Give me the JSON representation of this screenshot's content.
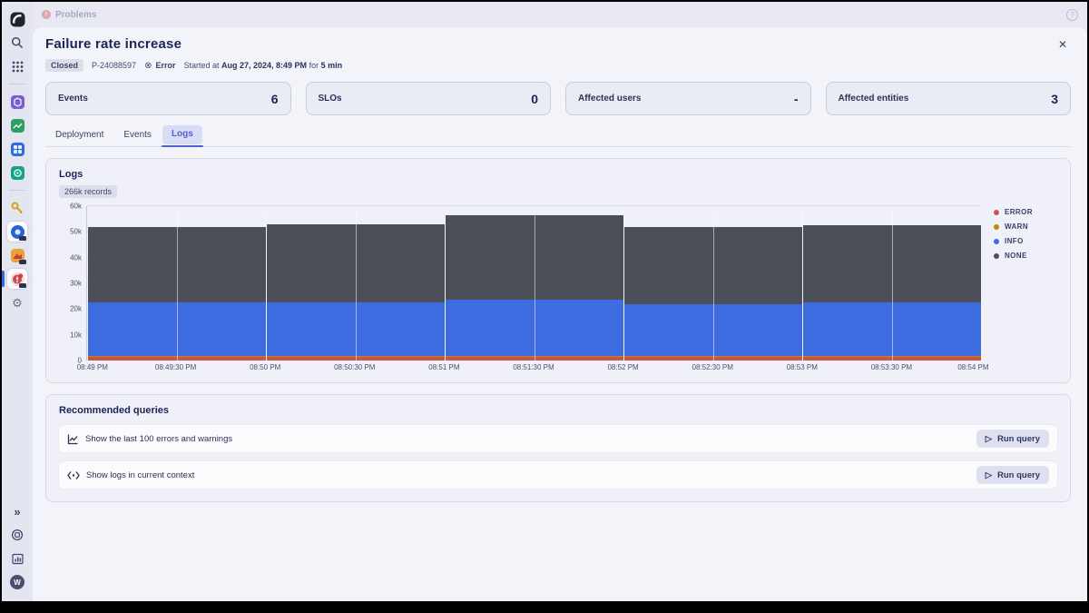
{
  "topbar": {
    "tab_label": "Problems",
    "help_glyph": "?"
  },
  "icons": {
    "close": "✕",
    "error_circle": "⊗",
    "gear": "⚙",
    "expand": "»",
    "play": "▷",
    "problem_bang": "!"
  },
  "sidebar": {
    "user_initial": "W",
    "items": [
      "dynatrace-logo",
      "search",
      "app-grid",
      "kubernetes-app",
      "smartscape-app",
      "dashboards-app",
      "clouds-app",
      "access-keys-app",
      "grail-app",
      "extensions-app",
      "problems-app",
      "settings-app",
      "expand",
      "help",
      "monitoring",
      "user"
    ]
  },
  "header": {
    "title": "Failure rate increase",
    "status_badge": "Closed",
    "problem_id": "P-24088597",
    "severity": "Error",
    "started_prefix": "Started at",
    "started_date": "Aug 27, 2024, 8:49 PM",
    "for_word": "for",
    "duration": "5 min"
  },
  "stat_cards": [
    {
      "label": "Events",
      "value": "6"
    },
    {
      "label": "SLOs",
      "value": "0"
    },
    {
      "label": "Affected users",
      "value": "-"
    },
    {
      "label": "Affected entities",
      "value": "3"
    }
  ],
  "tabs": [
    {
      "label": "Deployment"
    },
    {
      "label": "Events"
    },
    {
      "label": "Logs"
    }
  ],
  "logs_panel": {
    "title": "Logs",
    "records_badge": "266k records"
  },
  "chart_data": {
    "type": "bar",
    "stacked": true,
    "title": "Logs",
    "categories": [
      "08:49 PM",
      "08:50 PM",
      "08:51 PM",
      "08:52 PM",
      "08:53 PM"
    ],
    "series": [
      {
        "name": "ERROR",
        "color": "#cc5150",
        "values": [
          1500,
          1500,
          1500,
          1500,
          1500
        ]
      },
      {
        "name": "WARN",
        "color": "#c08a00",
        "values": [
          200,
          200,
          200,
          200,
          200
        ]
      },
      {
        "name": "INFO",
        "color": "#3c6ce0",
        "values": [
          20800,
          20800,
          22000,
          20300,
          21000
        ]
      },
      {
        "name": "NONE",
        "color": "#4c4f58",
        "values": [
          29500,
          30500,
          32800,
          30000,
          29800
        ]
      }
    ],
    "x_ticks": [
      "08:49 PM",
      "08:49:30 PM",
      "08:50 PM",
      "08:50:30 PM",
      "08:51 PM",
      "08:51:30 PM",
      "08:52 PM",
      "08:52:30 PM",
      "08:53 PM",
      "08:53:30 PM",
      "08:54 PM"
    ],
    "y_ticks": [
      "0",
      "10k",
      "20k",
      "30k",
      "40k",
      "50k",
      "60k"
    ],
    "ylim": [
      0,
      60000
    ],
    "grid": true,
    "legend_position": "right"
  },
  "recommended": {
    "title": "Recommended queries",
    "run_label": "Run query",
    "items": [
      {
        "icon": "line-chart-icon",
        "label": "Show the last 100 errors and warnings"
      },
      {
        "icon": "code-icon",
        "label": "Show logs in current context"
      }
    ]
  }
}
